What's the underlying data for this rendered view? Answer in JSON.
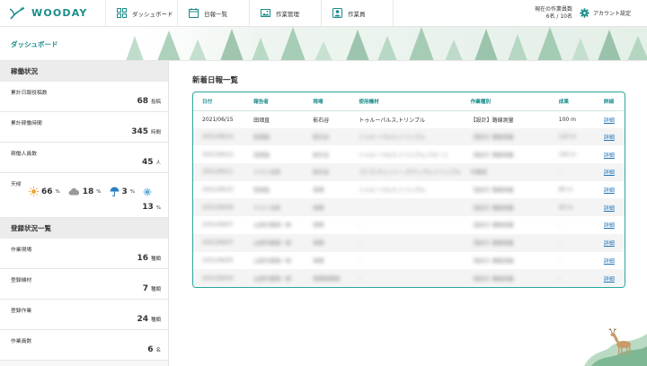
{
  "app": {
    "logo_text": "WOODAY",
    "nav": [
      {
        "label": "ダッシュボード",
        "icon": "dashboard-icon"
      },
      {
        "label": "日報一覧",
        "icon": "calendar-icon"
      },
      {
        "label": "作業管理",
        "icon": "image-icon"
      },
      {
        "label": "作業員",
        "icon": "person-icon"
      }
    ],
    "worker_count_label": "現在の作業員数",
    "worker_count_value": "6名 / 10名",
    "account_label": "アカウント設定",
    "accent_color": "#1a8c8a"
  },
  "page_title": "ダッシュボード",
  "sidebar": {
    "operation_heading": "稼働状況",
    "stats": [
      {
        "label": "累計日報投稿数",
        "value": "68",
        "unit": "投稿"
      },
      {
        "label": "累計稼働時間",
        "value": "345",
        "unit": "時間"
      },
      {
        "label": "稼働人員数",
        "value": "45",
        "unit": "人"
      }
    ],
    "weather": {
      "label": "天候",
      "sunny": {
        "value": "66",
        "unit": "%"
      },
      "cloudy": {
        "value": "18",
        "unit": "%"
      },
      "rainy": {
        "value": "3",
        "unit": "%"
      },
      "snow": {
        "value": "13",
        "unit": "%"
      }
    },
    "registration_heading": "登録状況一覧",
    "registrations": [
      {
        "label": "作業現場",
        "value": "16",
        "unit": "種類"
      },
      {
        "label": "登録機材",
        "value": "7",
        "unit": "種類"
      },
      {
        "label": "登録作業",
        "value": "24",
        "unit": "種類"
      },
      {
        "label": "作業員数",
        "value": "6",
        "unit": "名"
      }
    ]
  },
  "reports": {
    "title": "新着日報一覧",
    "columns": [
      "日付",
      "報告者",
      "現場",
      "使用機材",
      "作業種別",
      "成果",
      "詳細"
    ],
    "rows": [
      {
        "date": "2021/06/15",
        "reporter": "田畑直",
        "site": "影石谷",
        "equipment": "トゥルーパルス,トリンブル",
        "work": "【設計】路線測量",
        "result": "100 m",
        "detail": "詳細",
        "blurred": false
      },
      {
        "date": "2021/06/14",
        "reporter": "田畑直",
        "site": "影石谷",
        "equipment": "トゥルーパルス,トリンブル",
        "work": "【設計】路線測量",
        "result": "120 m",
        "detail": "詳細",
        "blurred": true
      },
      {
        "date": "2021/06/12",
        "reporter": "田畑直",
        "site": "影石谷",
        "equipment": "トゥルーパルス,トリンブル,ドローン",
        "work": "【設計】路線測量",
        "result": "100 m",
        "detail": "詳細",
        "blurred": true
      },
      {
        "date": "2021/06/11",
        "reporter": "テスト太郎",
        "site": "影石谷",
        "equipment": "ゴリラ,チェンソー,グラップル,トリンブル",
        "work": "作業道",
        "result": "-",
        "detail": "詳細",
        "blurred": true
      },
      {
        "date": "2021/06/10",
        "reporter": "田畑直",
        "site": "現場",
        "equipment": "トゥルーパルス,トリンブル",
        "work": "【設計】路線測量",
        "result": "80 m",
        "detail": "詳細",
        "blurred": true
      },
      {
        "date": "2021/06/09",
        "reporter": "テスト太郎",
        "site": "現場",
        "equipment": "-",
        "work": "【設計】路線測量",
        "result": "40 m",
        "detail": "詳細",
        "blurred": true
      },
      {
        "date": "2021/06/07",
        "reporter": "山田作業員一郎",
        "site": "現場",
        "equipment": "-",
        "work": "【設計】路線測量",
        "result": "-",
        "detail": "詳細",
        "blurred": true
      },
      {
        "date": "2021/06/07",
        "reporter": "山田作業員一郎",
        "site": "現場",
        "equipment": "-",
        "work": "【設計】路線測量",
        "result": "-",
        "detail": "詳細",
        "blurred": true
      },
      {
        "date": "2021/06/05",
        "reporter": "山田作業員一郎",
        "site": "現場",
        "equipment": "-",
        "work": "【設計】路線測量",
        "result": "-",
        "detail": "詳細",
        "blurred": true
      },
      {
        "date": "2021/06/04",
        "reporter": "山田作業員一郎",
        "site": "現場現場現",
        "equipment": "-",
        "work": "【設計】路線測量",
        "result": "-",
        "detail": "詳細",
        "blurred": true
      }
    ]
  }
}
